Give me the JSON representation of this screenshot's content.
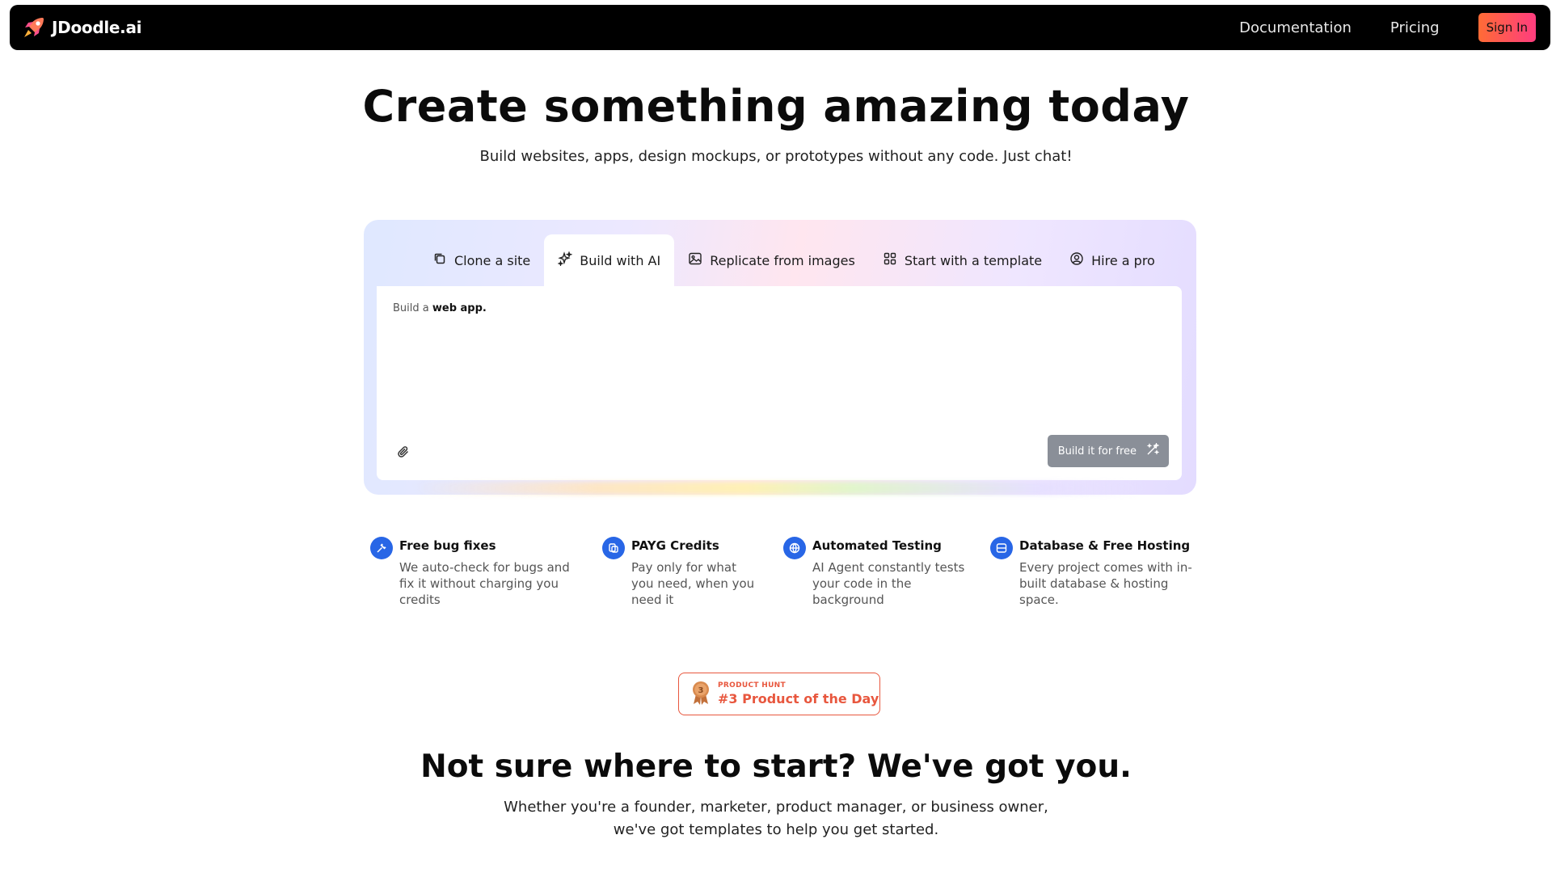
{
  "nav": {
    "brand": "JDoodle.ai",
    "links": [
      "Documentation",
      "Pricing"
    ],
    "signin": "Sign In"
  },
  "hero": {
    "title": "Create something amazing today",
    "subtitle": "Build websites, apps, design mockups, or prototypes without any code. Just chat!"
  },
  "builder": {
    "tabs": [
      {
        "label": "Clone a site",
        "icon": "copy-icon"
      },
      {
        "label": "Build with AI",
        "icon": "sparkles-icon",
        "active": true
      },
      {
        "label": "Replicate from images",
        "icon": "image-icon"
      },
      {
        "label": "Start with a template",
        "icon": "grid-icon"
      },
      {
        "label": "Hire a pro",
        "icon": "user-circle-icon"
      }
    ],
    "prompt_prefix": "Build a",
    "prompt_value": "web app.",
    "build_button": "Build it for free"
  },
  "features": [
    {
      "title": "Free bug fixes",
      "desc": "We auto-check for bugs and fix it without charging you credits",
      "icon": "wrench-icon"
    },
    {
      "title": "PAYG Credits",
      "desc": "Pay only for what you need, when you need it",
      "icon": "coins-icon"
    },
    {
      "title": "Automated Testing",
      "desc": "AI Agent constantly tests your code in the background",
      "icon": "globe-icon"
    },
    {
      "title": "Database & Free Hosting",
      "desc": "Every project comes with in-built database & hosting space.",
      "icon": "server-icon"
    }
  ],
  "product_hunt": {
    "small": "PRODUCT HUNT",
    "big": "#3 Product of the Day",
    "rank": "3"
  },
  "section2": {
    "title": "Not sure where to start? We've got you.",
    "subtitle_line1": "Whether you're a founder, marketer, product manager, or business owner,",
    "subtitle_line2": "we've got templates to help you get started."
  },
  "colors": {
    "nav_bg": "#000000",
    "accent_orange": "#e8573e",
    "feature_blue": "#2866e6",
    "build_button": "#8a8f98"
  }
}
